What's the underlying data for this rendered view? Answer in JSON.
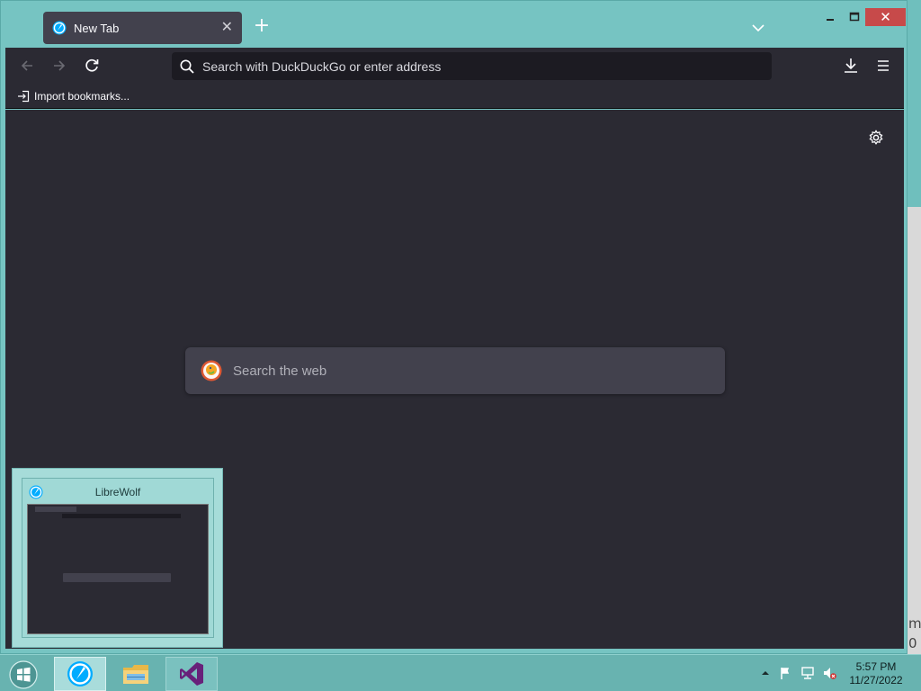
{
  "browser": {
    "tab_title": "New Tab",
    "tab_close": "✕",
    "new_tab": "+",
    "close_window": "✕",
    "urlbar_placeholder": "Search with DuckDuckGo or enter address",
    "bookmarks_import": "Import bookmarks...",
    "newtab_search_placeholder": "Search the web"
  },
  "preview": {
    "title": "LibreWolf"
  },
  "taskbar": {
    "time": "5:57 PM",
    "date": "11/27/2022"
  },
  "desktop_peek": {
    "line1": "m",
    "line2": "0"
  },
  "icons": [
    "librewolf-icon",
    "chevron-down-icon",
    "minimize-icon",
    "maximize-icon",
    "close-icon",
    "back-arrow-icon",
    "forward-arrow-icon",
    "reload-icon",
    "search-icon",
    "download-icon",
    "menu-icon",
    "import-icon",
    "gear-icon",
    "duckduckgo-icon",
    "windows-start-icon",
    "file-explorer-icon",
    "visual-studio-icon",
    "tray-arrow-icon",
    "flag-icon",
    "network-icon",
    "volume-muted-icon"
  ]
}
